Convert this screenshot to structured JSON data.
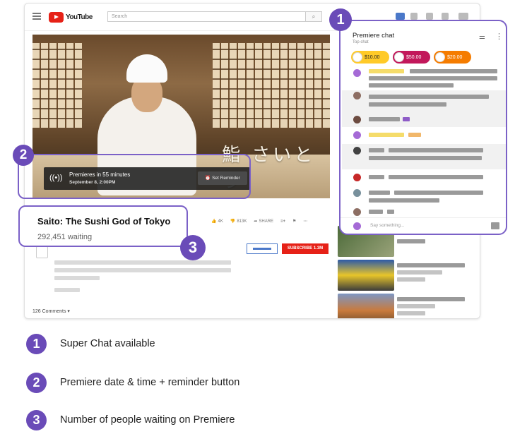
{
  "header": {
    "logo_text": "YouTube",
    "search_placeholder": "Search"
  },
  "video": {
    "overlay_text": "鮨 さいとう",
    "premiere_status": "Premieres in 55 minutes",
    "premiere_date": "September 8, 2:00PM",
    "reminder_label": "Set Reminder"
  },
  "details": {
    "title": "Saito: The Sushi God of Tokyo",
    "waiting": "292,451 waiting",
    "like_count": "4K",
    "dislike_count": "813K",
    "share_label": "SHARE",
    "subscribe_label": "SUBSCRIBE  1.3M",
    "comments_count": "126 Comments"
  },
  "chat": {
    "title": "Premiere chat",
    "subtitle": "Top chat",
    "input_placeholder": "Say something...",
    "superchats": [
      {
        "amount": "$10.00",
        "color": "#ffca28"
      },
      {
        "amount": "$50.00",
        "color": "#c2185b"
      },
      {
        "amount": "$20.00",
        "color": "#f57c00"
      }
    ]
  },
  "callouts": [
    "1",
    "2",
    "3"
  ],
  "legend": [
    {
      "num": "1",
      "text": "Super Chat available"
    },
    {
      "num": "2",
      "text": "Premiere date & time + reminder button"
    },
    {
      "num": "3",
      "text": "Number of people waiting on Premiere"
    }
  ],
  "colors": {
    "accent": "#6a4bb8",
    "youtube_red": "#e62117"
  }
}
